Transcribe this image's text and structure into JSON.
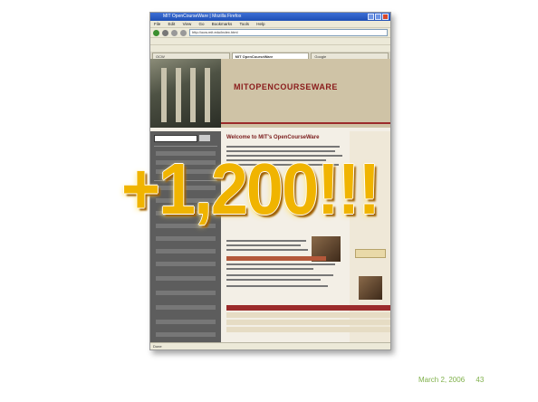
{
  "overlay": {
    "big_number": "+1,200!!!"
  },
  "footer": {
    "date": "March 2, 2006",
    "page_number": "43"
  },
  "browser": {
    "title": "MIT OpenCourseWare | Mozilla Firefox",
    "menu": [
      "File",
      "Edit",
      "View",
      "Go",
      "Bookmarks",
      "Tools",
      "Help"
    ],
    "address": "http://ocw.mit.edu/index.html",
    "tabs": [
      "OCW",
      "MIT OpenCourseWare",
      "Google"
    ],
    "status": "Done"
  },
  "site": {
    "logo": "MITOPENCOURSEWARE",
    "welcome": "Welcome to MIT's OpenCourseWare"
  },
  "colors": {
    "overlay": "#f0b400",
    "footer": "#7fb04a",
    "accent": "#9b2b2b"
  }
}
